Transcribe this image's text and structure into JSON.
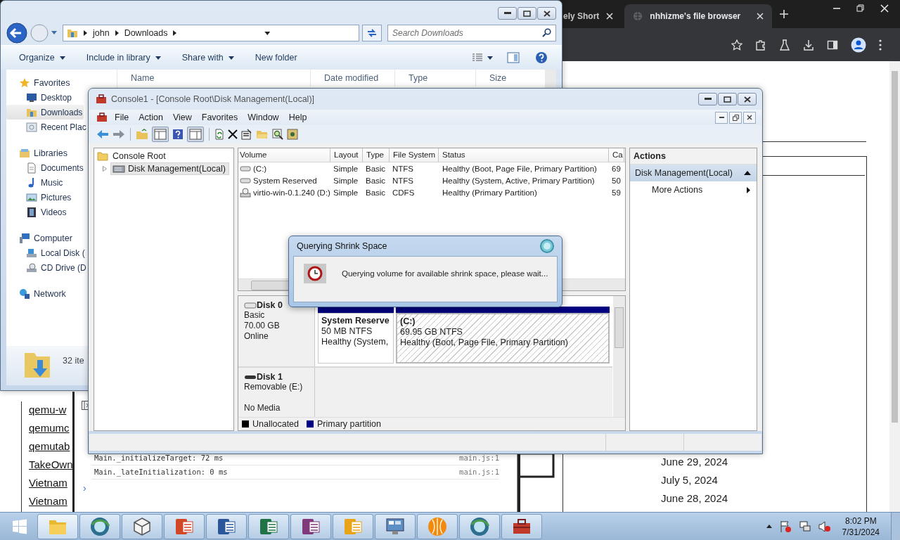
{
  "browser": {
    "tabs": [
      {
        "title": "ely Short",
        "selected": false
      },
      {
        "title": "nhhizme's file browser",
        "selected": true
      }
    ],
    "links": [
      "qemu-w",
      "qemumc",
      "qemutab",
      "TakeOwn",
      "Vietnam",
      "Vietnam"
    ],
    "console": [
      {
        "message": "Main._initializeTarget: 72 ms",
        "source": "main.js:1"
      },
      {
        "message": "Main._lateInitialization: 0 ms",
        "source": "main.js:1"
      }
    ],
    "prompt": "›",
    "dates": [
      "June 29, 2024",
      "July 5, 2024",
      "June 28, 2024"
    ]
  },
  "explorer": {
    "path": [
      "john",
      "Downloads"
    ],
    "search": {
      "placeholder": "Search Downloads"
    },
    "toolbar": [
      {
        "label": "Organize",
        "dropdown": true
      },
      {
        "label": "Include in library",
        "dropdown": true
      },
      {
        "label": "Share with",
        "dropdown": true
      },
      {
        "label": "New folder",
        "dropdown": false
      }
    ],
    "columns": [
      "Name",
      "Date modified",
      "Type",
      "Size"
    ],
    "nav": [
      {
        "label": "Favorites",
        "children": [
          {
            "label": "Desktop",
            "selected": false
          },
          {
            "label": "Downloads",
            "selected": true
          },
          {
            "label": "Recent Plac",
            "selected": false
          }
        ]
      },
      {
        "label": "Libraries",
        "children": [
          {
            "label": "Documents",
            "selected": false
          },
          {
            "label": "Music",
            "selected": false
          },
          {
            "label": "Pictures",
            "selected": false
          },
          {
            "label": "Videos",
            "selected": false
          }
        ]
      },
      {
        "label": "Computer",
        "children": [
          {
            "label": "Local Disk (",
            "selected": false
          },
          {
            "label": "CD Drive (D",
            "selected": false
          }
        ]
      },
      {
        "label": "Network"
      }
    ],
    "status": "32 ite"
  },
  "console": {
    "title": "Console1 - [Console Root\\Disk Management(Local)]",
    "menu": [
      "File",
      "Action",
      "View",
      "Favorites",
      "Window",
      "Help"
    ],
    "tree": [
      {
        "label": "Console Root",
        "children": [
          {
            "label": "Disk Management(Local)",
            "selected": true
          }
        ]
      }
    ],
    "columns": [
      "Volume",
      "Layout",
      "Type",
      "File System",
      "Status",
      "Ca"
    ],
    "volumes": [
      {
        "volume": "(C:)",
        "layout": "Simple",
        "type": "Basic",
        "file_system": "NTFS",
        "status": "Healthy (Boot, Page File, Primary Partition)",
        "capacity": "69"
      },
      {
        "volume": "System Reserved",
        "layout": "Simple",
        "type": "Basic",
        "file_system": "NTFS",
        "status": "Healthy (System, Active, Primary Partition)",
        "capacity": "50"
      },
      {
        "volume": "virtio-win-0.1.240 (D:)",
        "layout": "Simple",
        "type": "Basic",
        "file_system": "CDFS",
        "status": "Healthy (Primary Partition)",
        "capacity": "59"
      }
    ],
    "disks": [
      {
        "name": "Disk 0",
        "type": "Basic",
        "size": "70.00 GB",
        "status": "Online",
        "partitions": [
          {
            "name": "System Reserve",
            "detail": "50 MB NTFS",
            "status": "Healthy (System,",
            "color": "#000080",
            "selected": false
          },
          {
            "name": "(C:)",
            "detail": "69.95 GB NTFS",
            "status": "Healthy (Boot, Page File, Primary Partition)",
            "color": "#000080",
            "selected": true
          }
        ]
      },
      {
        "name": "Disk 1",
        "type": "Removable (E:)",
        "status": "No Media"
      }
    ],
    "legend": [
      {
        "label": "Unallocated",
        "color": "#000000"
      },
      {
        "label": "Primary partition",
        "color": "#000080"
      }
    ],
    "actions": {
      "title": "Actions",
      "section": "Disk Management(Local)",
      "items": [
        "More Actions"
      ]
    }
  },
  "dialog": {
    "title": "Querying Shrink Space",
    "message": "Querying volume for available shrink space, please wait..."
  },
  "clock": {
    "time": "8:02 PM",
    "date": "7/31/2024"
  }
}
